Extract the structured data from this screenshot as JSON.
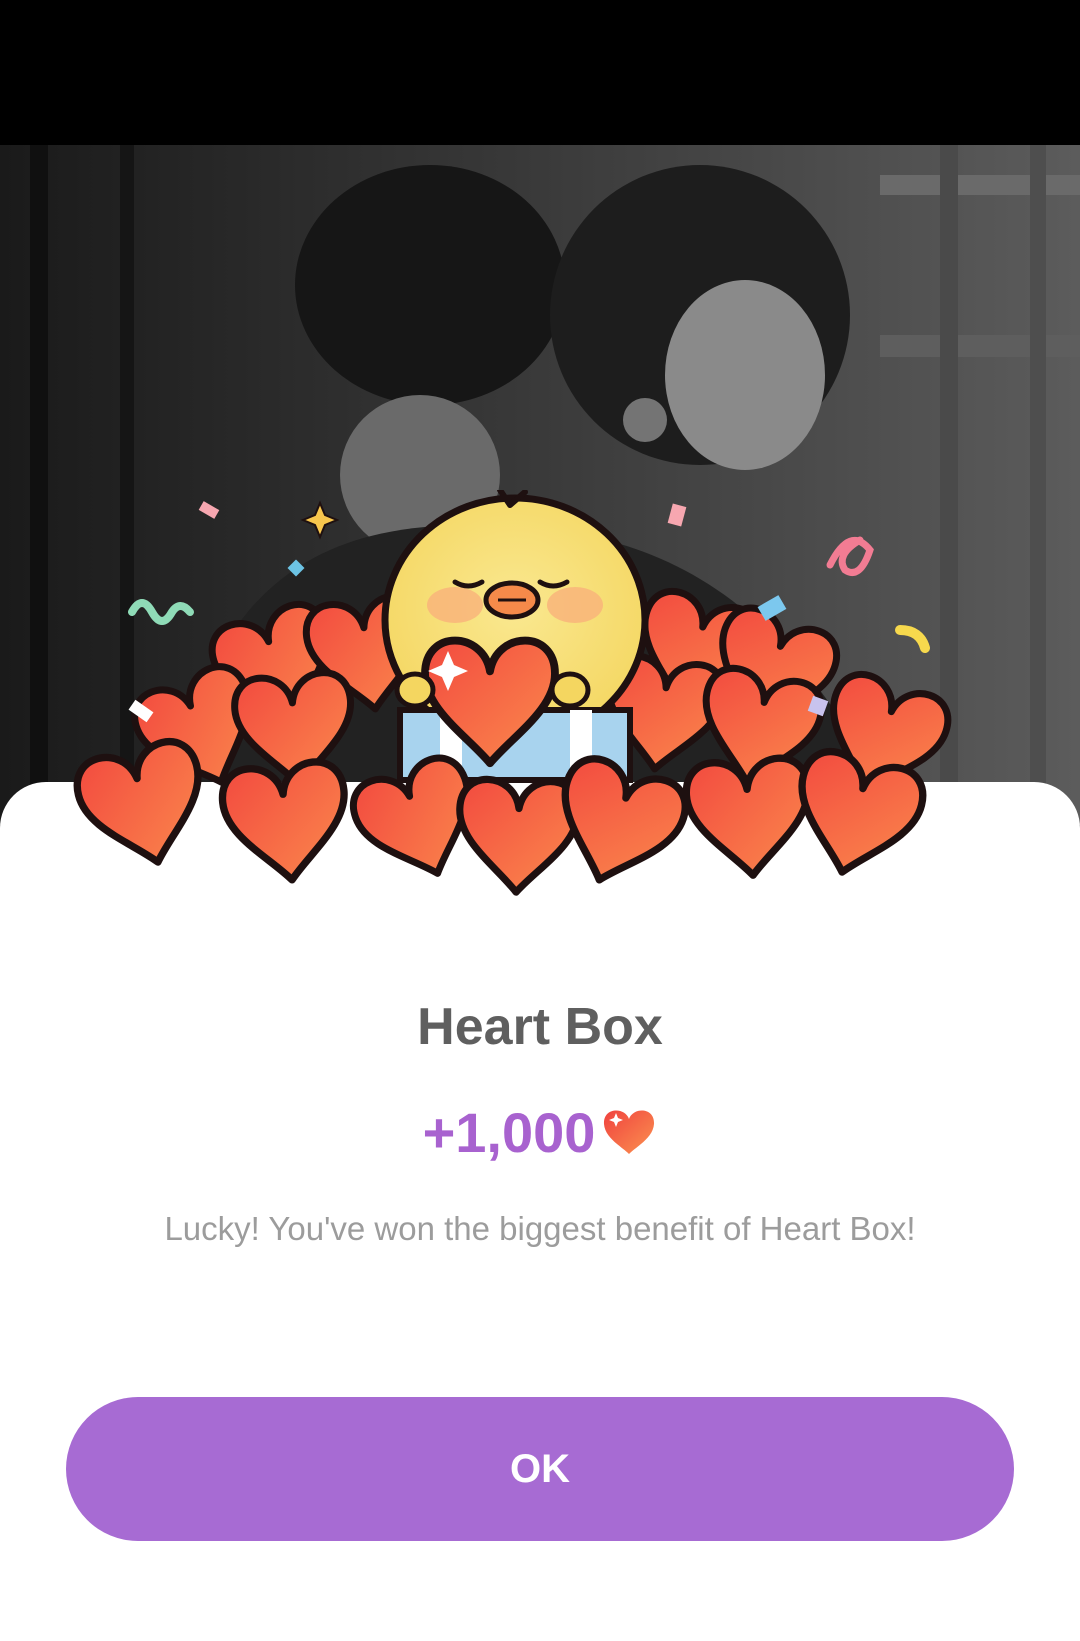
{
  "dialog": {
    "title": "Heart Box",
    "reward_amount": "+1,000",
    "reward_icon": "heart-icon",
    "message": "Lucky! You've won the biggest benefit of Heart Box!",
    "ok_label": "OK"
  },
  "colors": {
    "accent": "#a76bd3",
    "reward_text": "#a862cf",
    "title_text": "#5f5f5f",
    "message_text": "#9c9c9c",
    "heart": "#f3593f"
  }
}
